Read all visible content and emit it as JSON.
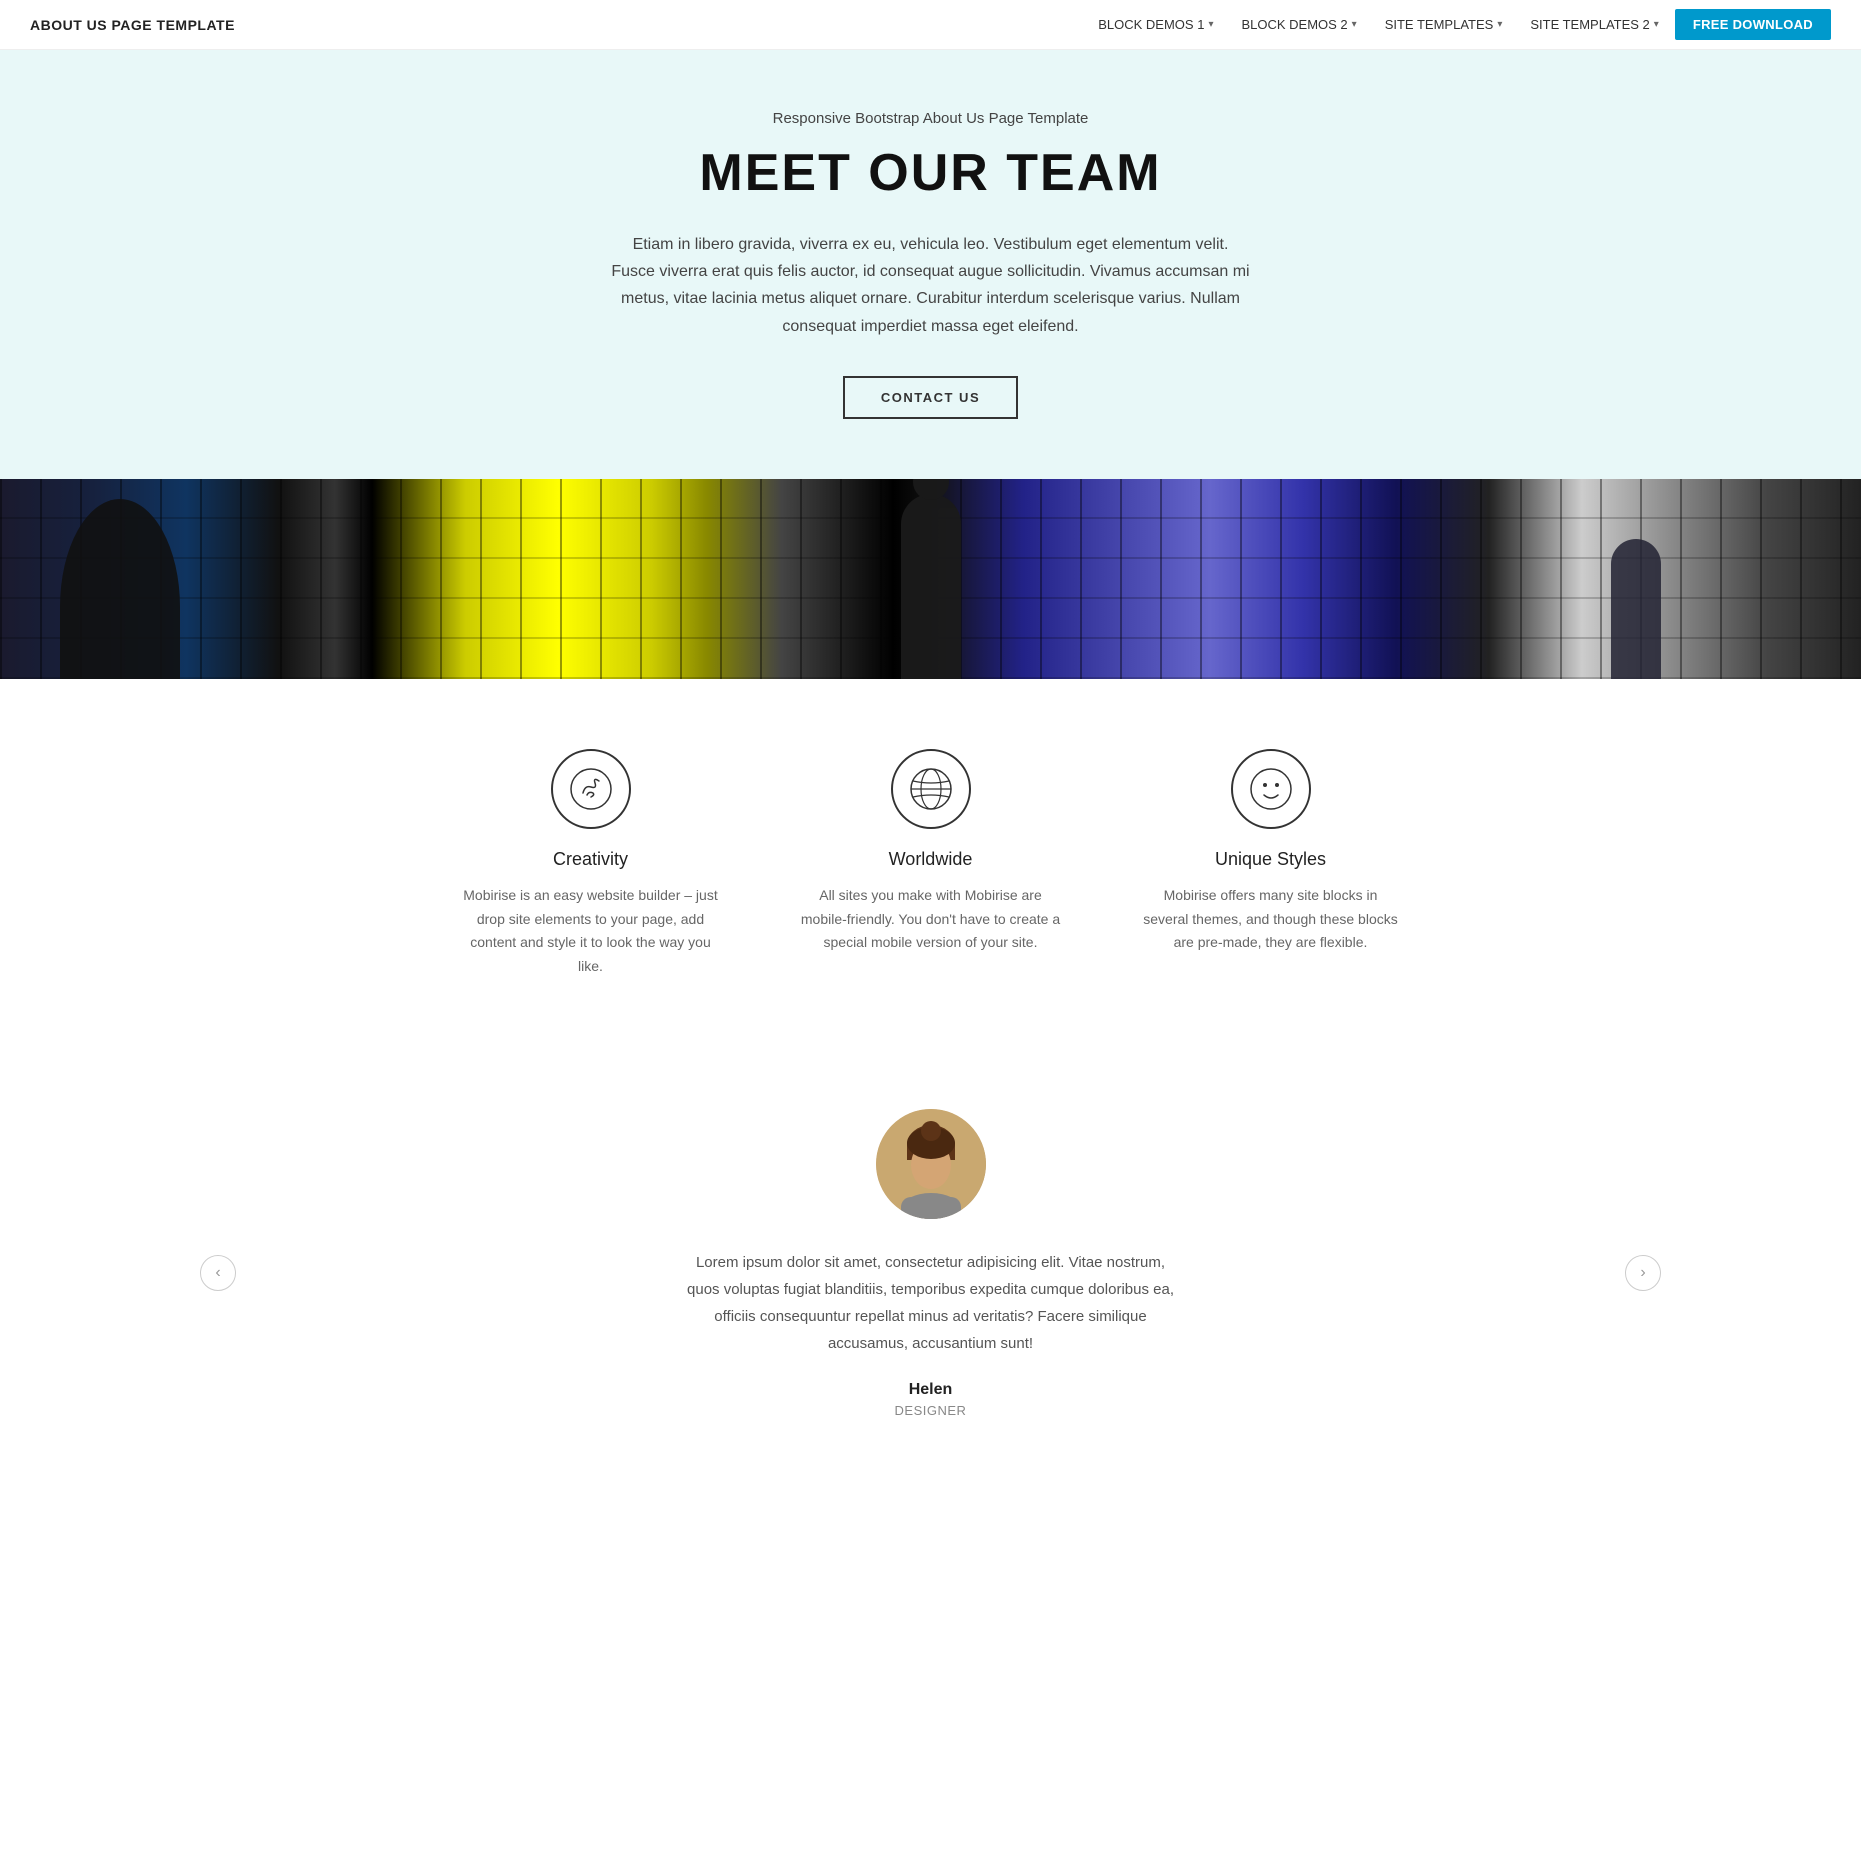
{
  "navbar": {
    "brand": "ABOUT US PAGE TEMPLATE",
    "nav_items": [
      {
        "label": "BLOCK DEMOS 1",
        "has_caret": true
      },
      {
        "label": "BLOCK DEMOS 2",
        "has_caret": true
      },
      {
        "label": "SITE TEMPLATES",
        "has_caret": true
      },
      {
        "label": "SITE TEMPLATES 2",
        "has_caret": true
      }
    ],
    "download_button": "FREE DOWNLOAD"
  },
  "hero": {
    "subtitle": "Responsive Bootstrap About Us Page Template",
    "title": "MEET OUR TEAM",
    "text": "Etiam in libero gravida, viverra ex eu, vehicula leo. Vestibulum eget elementum velit. Fusce viverra erat quis felis auctor, id consequat augue sollicitudin. Vivamus accumsan mi metus, vitae lacinia metus aliquet ornare. Curabitur interdum scelerisque varius. Nullam consequat imperdiet massa eget eleifend.",
    "contact_button": "CONTACT US"
  },
  "features": {
    "items": [
      {
        "icon": "🐚",
        "title": "Creativity",
        "text": "Mobirise is an easy website builder – just drop site elements to your page, add content and style it to look the way you like.",
        "icon_name": "creativity-icon"
      },
      {
        "icon": "🌐",
        "title": "Worldwide",
        "text": "All sites you make with Mobirise are mobile-friendly. You don't have to create a special mobile version of your site.",
        "icon_name": "worldwide-icon"
      },
      {
        "icon": "🙂",
        "title": "Unique Styles",
        "text": "Mobirise offers many site blocks in several themes, and though these blocks are pre-made, they are flexible.",
        "icon_name": "unique-styles-icon"
      }
    ]
  },
  "testimonial": {
    "text": "Lorem ipsum dolor sit amet, consectetur adipisicing elit. Vitae nostrum, quos voluptas fugiat blanditiis, temporibus expedita cumque doloribus ea, officiis consequuntur repellat minus ad veritatis? Facere similique accusamus, accusantium sunt!",
    "name": "Helen",
    "role": "DESIGNER",
    "prev_label": "‹",
    "next_label": "›"
  }
}
